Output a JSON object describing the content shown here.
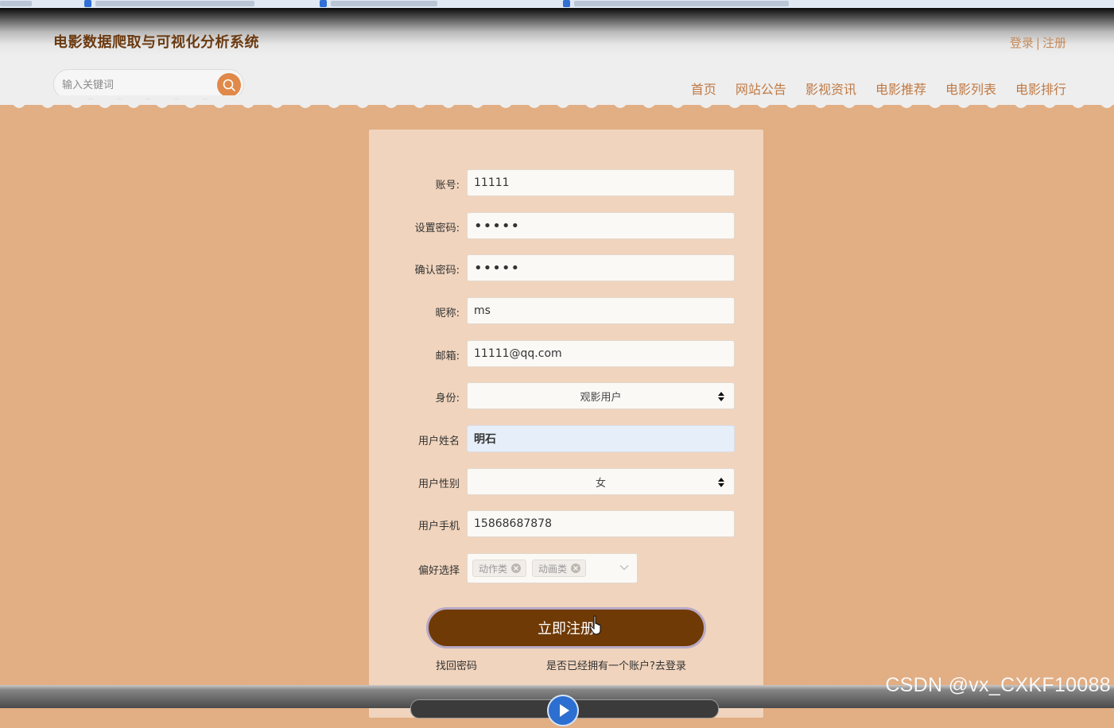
{
  "header": {
    "site_title": "电影数据爬取与可视化分析系统",
    "login_link": "登录",
    "divider": "|",
    "register_link": "注册",
    "search": {
      "placeholder": "输入关键词"
    },
    "nav": [
      "首页",
      "网站公告",
      "影视资讯",
      "电影推荐",
      "电影列表",
      "电影排行"
    ]
  },
  "form": {
    "account": {
      "label": "账号:",
      "value": "11111"
    },
    "password": {
      "label": "设置密码:",
      "value": "•••••"
    },
    "confirm_password": {
      "label": "确认密码:",
      "value": "•••••"
    },
    "nickname": {
      "label": "昵称:",
      "value": "ms"
    },
    "email": {
      "label": "邮箱:",
      "value": "11111@qq.com"
    },
    "identity": {
      "label": "身份:",
      "value": "观影用户"
    },
    "real_name": {
      "label": "用户姓名",
      "value": "明石"
    },
    "gender": {
      "label": "用户性别",
      "value": "女"
    },
    "phone": {
      "label": "用户手机",
      "value": "15868687878"
    },
    "preference": {
      "label": "偏好选择",
      "tags": [
        "动作类",
        "动画类"
      ]
    },
    "submit_label": "立即注册",
    "forgot_password": "找回密码",
    "have_account": "是否已经拥有一个账户?去登录"
  },
  "watermark": "CSDN @vx_CXKF10088",
  "colors": {
    "page_background": "#e2ae83",
    "panel_background": "#f0d4bd",
    "title_brown": "#6b3a10",
    "nav_link": "#c07a45",
    "search_button": "#e0894a",
    "submit_button": "#6f3a06"
  }
}
